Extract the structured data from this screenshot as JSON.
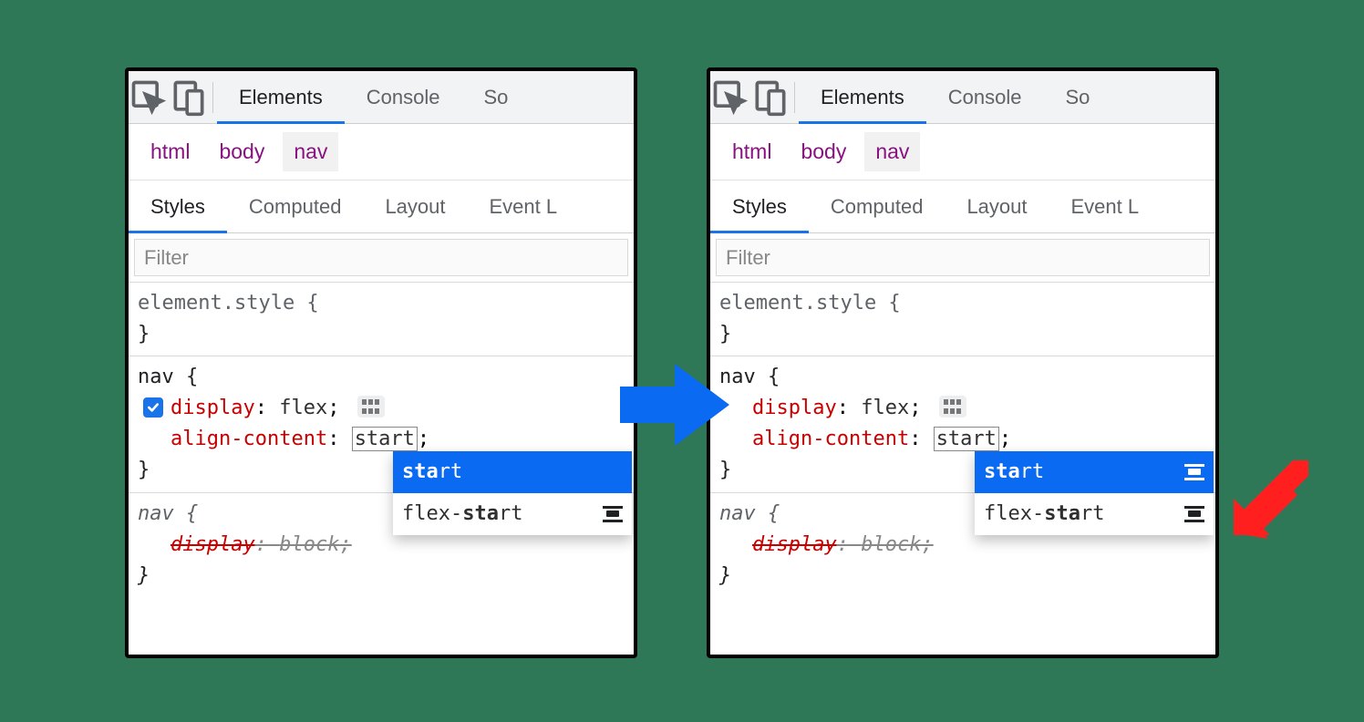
{
  "toolbar": {
    "tabs": [
      "Elements",
      "Console",
      "So"
    ]
  },
  "crumbs": [
    "html",
    "body",
    "nav"
  ],
  "subtabs": [
    "Styles",
    "Computed",
    "Layout",
    "Event L"
  ],
  "filter_placeholder": "Filter",
  "rules": {
    "element_style": "element.style {",
    "close": "}",
    "nav_open": "nav {",
    "display_prop": "display",
    "display_val": "flex",
    "align_prop": "align-content",
    "align_val": "start",
    "semicolon": ";",
    "ua_nav": "nav {",
    "ua_display_prop": "display",
    "ua_display_val": "block"
  },
  "autocomplete": {
    "opt1_bold": "sta",
    "opt1_rest": "rt",
    "opt2_pre": "flex-",
    "opt2_bold": "sta",
    "opt2_rest": "rt"
  }
}
